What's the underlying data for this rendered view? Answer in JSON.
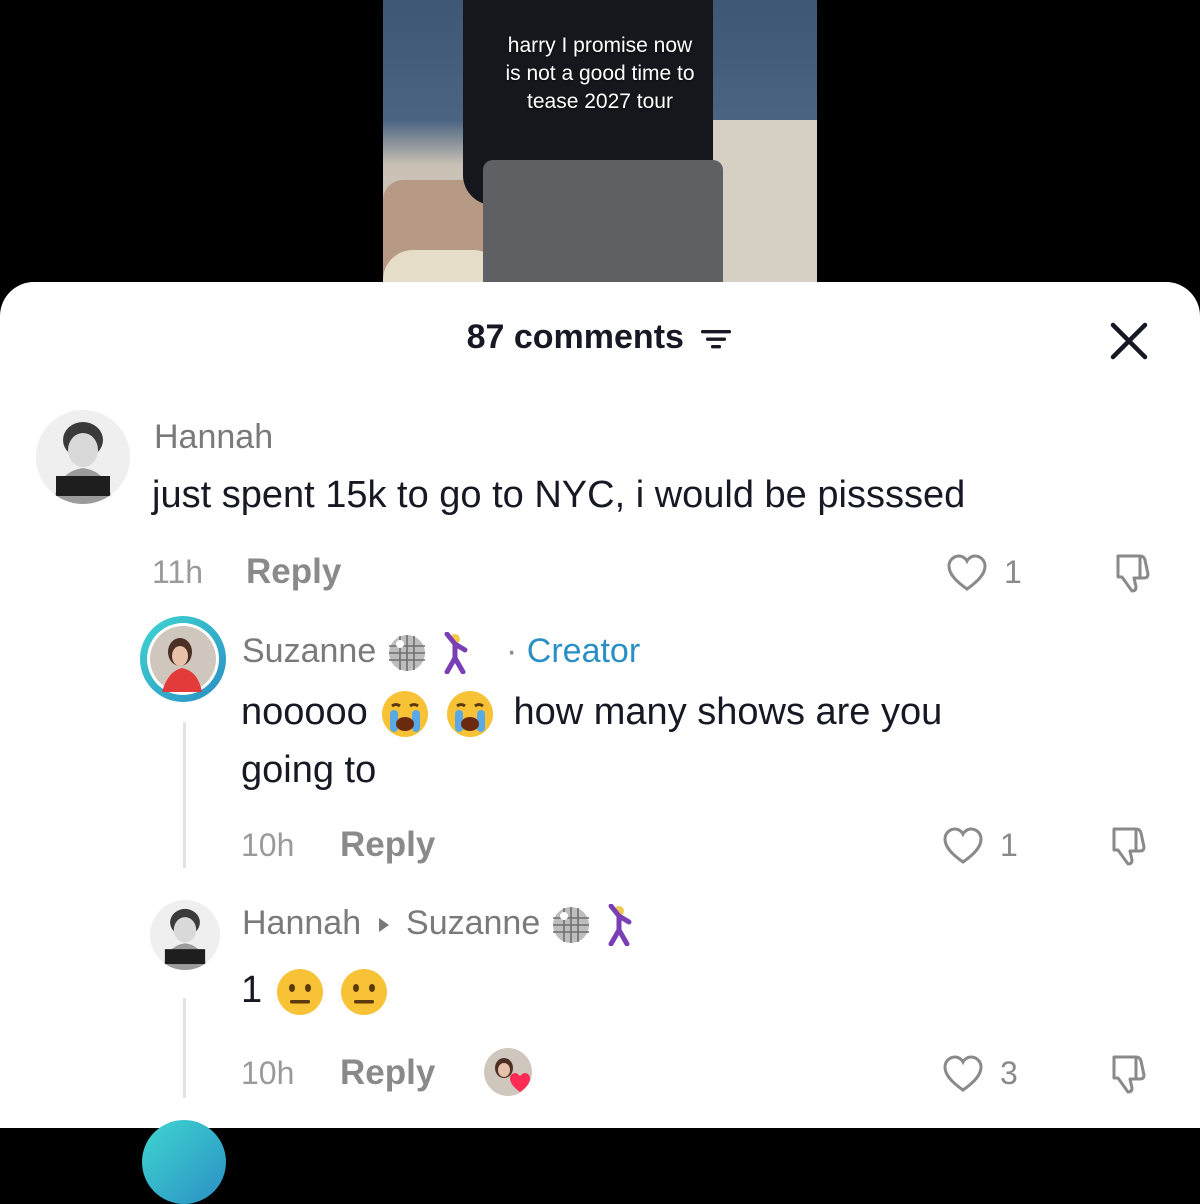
{
  "video": {
    "caption": "harry I promise now\nis not a good time to\ntease 2027 tour"
  },
  "sheet": {
    "comments_count": "87 comments"
  },
  "comments": [
    {
      "username": "Hannah",
      "text": "just spent 15k to go to NYC, i would be pissssed",
      "time": "11h",
      "reply_label": "Reply",
      "likes": "1"
    },
    {
      "username": "Suzanne",
      "creator_separator": "·",
      "creator_label": "Creator",
      "text_part1": "nooooo",
      "text_part2": "how many shows are you",
      "text_line2": "going to",
      "time": "10h",
      "reply_label": "Reply",
      "likes": "1"
    },
    {
      "username": "Hannah",
      "reply_to": "Suzanne",
      "text": "1",
      "time": "10h",
      "reply_label": "Reply",
      "likes": "3"
    }
  ],
  "colors": {
    "creator_blue": "#2a8fc4",
    "text_dark": "#161823",
    "text_gray": "#8a8a8a"
  }
}
